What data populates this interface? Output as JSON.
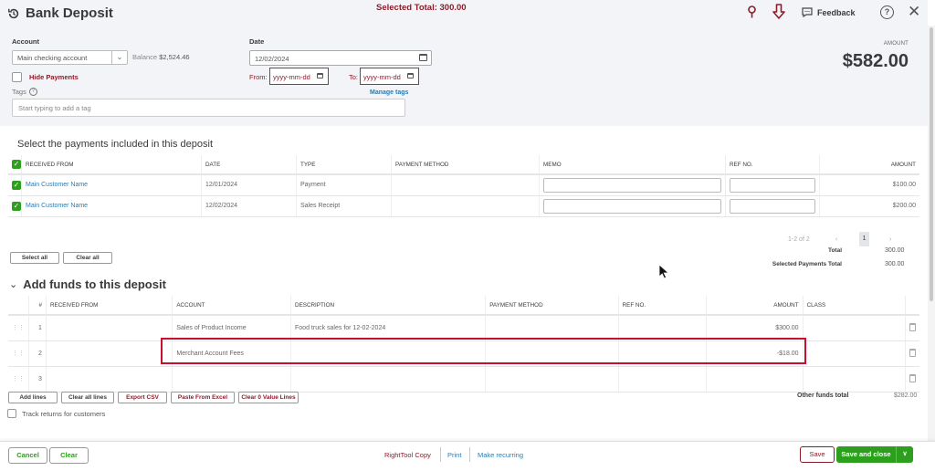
{
  "header": {
    "title": "Bank Deposit",
    "selected_total": "Selected Total: 300.00",
    "feedback_label": "Feedback",
    "help_glyph": "?",
    "close_glyph": "✕",
    "icons": [
      "history-icon",
      "pin-icon",
      "download-arrow-icon",
      "feedback-icon",
      "help-icon",
      "close-icon"
    ]
  },
  "form": {
    "account_label": "Account",
    "account_value": "Main checking account",
    "balance_label": "Balance",
    "balance_value": "$2,524.46",
    "hide_payments_label": "Hide Payments",
    "hide_payments_checked": false,
    "tags_label": "Tags",
    "tags_placeholder": "Start typing to add a tag",
    "date_label": "Date",
    "date_value": "12/02/2024",
    "from_label": "From:",
    "from_placeholder": "yyyy-mm-dd",
    "to_label": "To:",
    "to_placeholder": "yyyy-mm-dd",
    "manage_tags": "Manage tags",
    "amount_label": "AMOUNT",
    "amount_value": "$582.00"
  },
  "payments": {
    "title": "Select the payments included in this deposit",
    "columns": [
      "RECEIVED FROM",
      "DATE",
      "TYPE",
      "PAYMENT METHOD",
      "MEMO",
      "REF NO.",
      "AMOUNT"
    ],
    "rows": [
      {
        "checked": true,
        "received_from": "Main Customer Name",
        "date": "12/01/2024",
        "type": "Payment",
        "payment_method": "",
        "memo": "",
        "ref_no": "",
        "amount": "$100.00"
      },
      {
        "checked": true,
        "received_from": "Main Customer Name",
        "date": "12/02/2024",
        "type": "Sales Receipt",
        "payment_method": "",
        "memo": "",
        "ref_no": "",
        "amount": "$200.00"
      }
    ],
    "pager": {
      "range": "1-2 of 2",
      "prev": "‹",
      "page": "1",
      "next": "›"
    },
    "total_label": "Total",
    "total_value": "300.00",
    "selected_total_label": "Selected Payments Total",
    "selected_total_value": "300.00",
    "select_all": "Select all",
    "clear_all": "Clear all"
  },
  "funds": {
    "title": "Add funds to this deposit",
    "columns": [
      "#",
      "RECEIVED FROM",
      "ACCOUNT",
      "DESCRIPTION",
      "PAYMENT METHOD",
      "REF NO.",
      "AMOUNT",
      "CLASS"
    ],
    "rows": [
      {
        "num": "1",
        "received_from": "",
        "account": "Sales of Product Income",
        "description": "Food truck sales for 12-02-2024",
        "payment_method": "",
        "ref_no": "",
        "amount": "$300.00",
        "class": ""
      },
      {
        "num": "2",
        "received_from": "",
        "account": "Merchant Account Fees",
        "description": "",
        "payment_method": "",
        "ref_no": "",
        "amount": "-$18.00",
        "class": ""
      },
      {
        "num": "3",
        "received_from": "",
        "account": "",
        "description": "",
        "payment_method": "",
        "ref_no": "",
        "amount": "",
        "class": ""
      }
    ],
    "buttons": {
      "add_lines": "Add lines",
      "clear_all_lines": "Clear all lines",
      "export_csv": "Export CSV",
      "paste_from_excel": "Paste From Excel",
      "clear_zero": "Clear 0 Value Lines"
    },
    "other_total_label": "Other funds total",
    "other_total_value": "$282.00",
    "track_returns_label": "Track returns for customers",
    "track_returns_checked": false
  },
  "footer": {
    "cancel": "Cancel",
    "clear": "Clear",
    "righttool_copy": "RightTool Copy",
    "print": "Print",
    "make_recurring": "Make recurring",
    "save": "Save",
    "save_and_close": "Save and close",
    "dropdown_glyph": "∨"
  },
  "colors": {
    "brand_green": "#2ca01c",
    "accent_red": "#8d1c2a",
    "link_blue": "#2c7cb0",
    "highlight_red": "#c8102e"
  }
}
